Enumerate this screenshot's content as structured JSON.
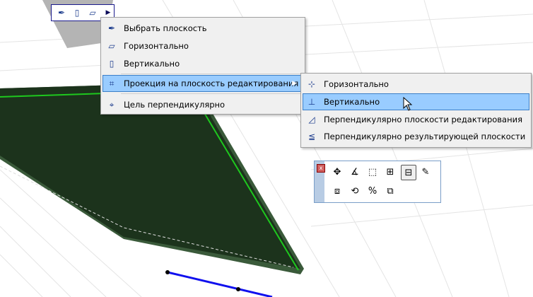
{
  "toolbar": {
    "icons": [
      "select-plane-icon",
      "vertical-plane-icon",
      "horizontal-plane-icon",
      "expand-arrow-icon"
    ]
  },
  "menu": {
    "items": [
      {
        "label": "Выбрать плоскость",
        "icon": "select-plane-icon"
      },
      {
        "label": "Горизонтально",
        "icon": "horizontal-plane-icon"
      },
      {
        "label": "Вертикально",
        "icon": "vertical-plane-icon"
      },
      {
        "label": "Проекция на плоскость редактирования",
        "icon": "projection-icon",
        "highlighted": true,
        "submenu": true
      },
      {
        "label": "Цель перпендикулярно",
        "icon": "target-perpendicular-icon"
      }
    ]
  },
  "submenu": {
    "items": [
      {
        "label": "Горизонтально",
        "icon": "horizontal-projection-icon"
      },
      {
        "label": "Вертикально",
        "icon": "vertical-projection-icon",
        "highlighted": true
      },
      {
        "label": "Перпендикулярно плоскости редактирования",
        "icon": "perpendicular-edit-plane-icon"
      },
      {
        "label": "Перпендикулярно результирующей плоскости",
        "icon": "perpendicular-result-plane-icon"
      }
    ]
  },
  "panel": {
    "close_label": "x",
    "tools": [
      "move",
      "rotate",
      "stretch",
      "add-polygon",
      "subtract-polygon",
      "elevate",
      "drag-3d",
      "rotate-3d",
      "split",
      "merge"
    ]
  },
  "colors": {
    "highlight": "#99ccff",
    "polygon": "#1e3a1e",
    "edge": "#1ec81e",
    "line": "#1010ee"
  }
}
